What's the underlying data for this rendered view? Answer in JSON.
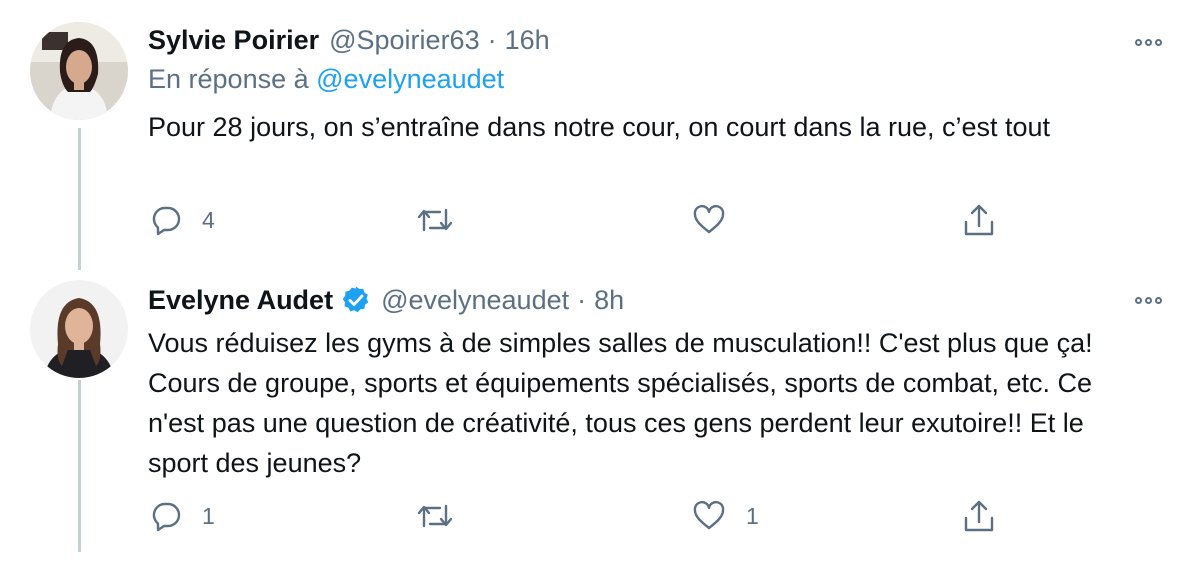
{
  "tweets": [
    {
      "author": "Sylvie Poirier",
      "handle": "@Spoirier63",
      "separator": "·",
      "time": "16h",
      "verified": false,
      "reply_prefix": "En réponse à",
      "reply_to": "@evelyneaudet",
      "text": "Pour 28 jours, on s’entraîne dans notre cour, on court dans la rue, c’est tout",
      "replies": "4",
      "retweets": "",
      "likes": ""
    },
    {
      "author": "Evelyne Audet",
      "handle": "@evelyneaudet",
      "separator": "·",
      "time": "8h",
      "verified": true,
      "text": "Vous réduisez les gyms à de simples salles de musculation!! C'est plus que ça! Cours de groupe, sports et équipements spécialisés, sports de combat, etc. Ce n'est pas une question de créativité, tous ces gens perdent leur exutoire!! Et le sport des jeunes?",
      "replies": "1",
      "retweets": "",
      "likes": "1"
    }
  ],
  "icons": {
    "reply": "speech-bubble-icon",
    "retweet": "retweet-arrows-icon",
    "like": "heart-icon",
    "share": "share-upload-icon",
    "more": "three-dots-icon",
    "verified": "verified-badge-icon"
  },
  "colors": {
    "accent": "#1da1f2",
    "secondary_text": "#5b7083",
    "thread_line": "#c4cfd6"
  }
}
